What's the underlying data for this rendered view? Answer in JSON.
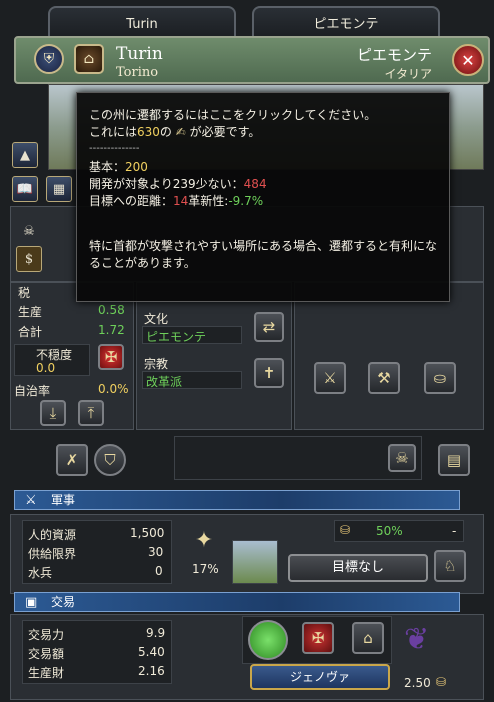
{
  "tabs": {
    "left": "Turin",
    "right": "ピエモンテ"
  },
  "header": {
    "title": "Turin",
    "subtitle": "Torino",
    "region": "ピエモンテ",
    "country": "イタリア"
  },
  "economy": {
    "tax_label": "税",
    "production_label": "生産",
    "production_value": "0.58",
    "total_label": "合計",
    "total_value": "1.72",
    "unrest_label": "不穏度",
    "unrest_value": "0.0",
    "autonomy_label": "自治率",
    "autonomy_value": "0.0%"
  },
  "culture": {
    "culture_label": "文化",
    "culture_value": "ピエモンテ",
    "religion_label": "宗教",
    "religion_value": "改革派"
  },
  "military": {
    "section_title": "軍事",
    "manpower_label": "人的資源",
    "manpower_value": "1,500",
    "supply_label": "供給限界",
    "supply_value": "30",
    "sailors_label": "水兵",
    "sailors_value": "0",
    "fort_percent": "17%",
    "progress_value": "50%",
    "progress_end": "-",
    "goal_label": "目標なし"
  },
  "trade": {
    "section_title": "交易",
    "power_label": "交易力",
    "power_value": "9.9",
    "value_label": "交易額",
    "value_value": "5.40",
    "goods_label": "生産財",
    "goods_value": "2.16",
    "node_label": "ジェノヴァ",
    "goods_price": "2.50"
  },
  "tooltip": {
    "line1": "この州に遷都するにはここをクリックしてください。",
    "line2_pre": "これには",
    "line2_cost": "630",
    "line2_post": "の",
    "line2_end": "が必要です。",
    "separator": "--------------",
    "base_label": "基本：",
    "base_value": "200",
    "dev_label": "開発が対象より239少ない：",
    "dev_value": "484",
    "dist_label": "目標への距離：",
    "dist_value": "14",
    "innov_label": "革新性:",
    "innov_value": "-9.7%",
    "note1": "特に首都が攻撃されやすい場所にある場合、遷都すると有利にな",
    "note2": "ることがあります。"
  },
  "colors": {
    "positive": "#6ed05a",
    "negative": "#e05050",
    "highlight": "#f0d060"
  }
}
